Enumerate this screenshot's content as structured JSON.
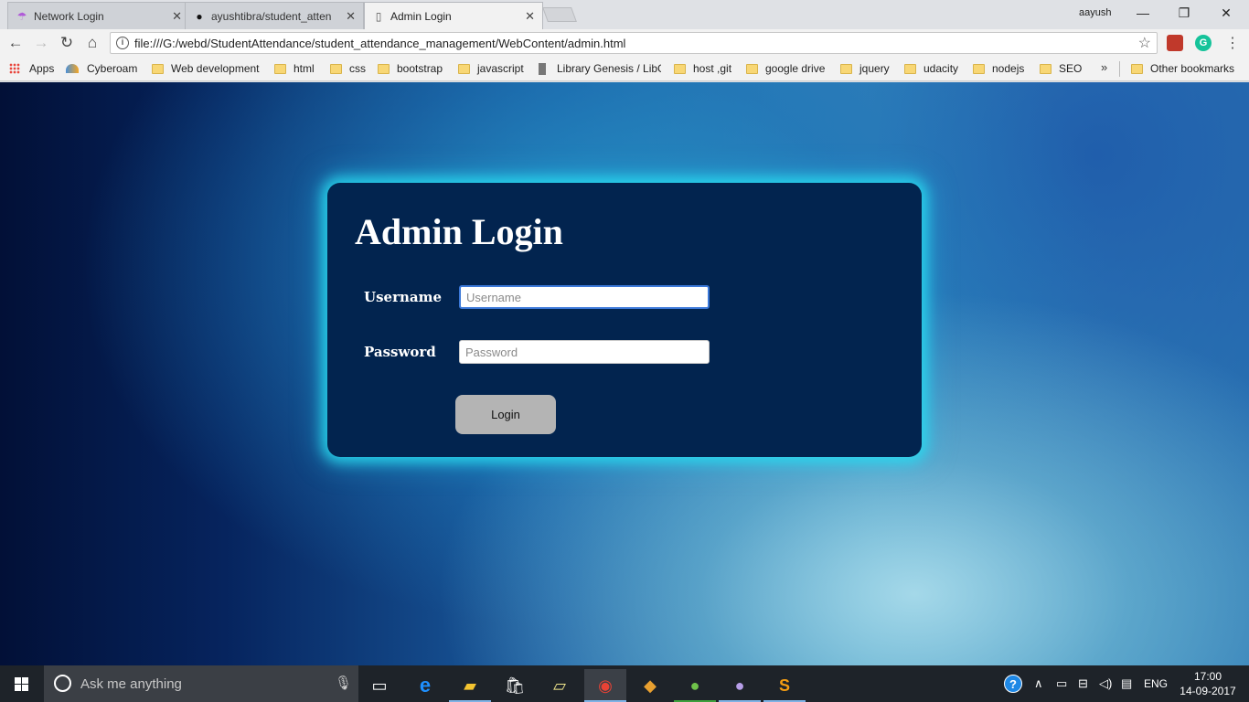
{
  "browser": {
    "tabs": [
      {
        "title": "Network Login",
        "icon": "network-icon",
        "active": false
      },
      {
        "title": "ayushtibra/student_atten",
        "icon": "github-icon",
        "active": false
      },
      {
        "title": "Admin Login",
        "icon": "page-icon",
        "active": true
      }
    ],
    "profile_name": "aayush",
    "url": "file:///G:/webd/StudentAttendance/student_attendance_management/WebContent/admin.html"
  },
  "bookmarks": {
    "items": [
      {
        "label": "Apps",
        "icon": "apps-grid-icon"
      },
      {
        "label": "Cyberoam",
        "icon": "cyberoam-icon"
      },
      {
        "label": "Web development",
        "icon": "folder-icon"
      },
      {
        "label": "html",
        "icon": "folder-icon"
      },
      {
        "label": "css",
        "icon": "folder-icon"
      },
      {
        "label": "bootstrap",
        "icon": "folder-icon"
      },
      {
        "label": "javascript",
        "icon": "folder-icon"
      },
      {
        "label": "Library Genesis / LibG",
        "icon": "book-icon"
      },
      {
        "label": "host ,git",
        "icon": "folder-icon"
      },
      {
        "label": "google drive",
        "icon": "folder-icon"
      },
      {
        "label": "jquery",
        "icon": "folder-icon"
      },
      {
        "label": "udacity",
        "icon": "folder-icon"
      },
      {
        "label": "nodejs",
        "icon": "folder-icon"
      },
      {
        "label": "SEO",
        "icon": "folder-icon"
      }
    ],
    "overflow": "»",
    "other": "Other bookmarks"
  },
  "login": {
    "title": "Admin Login",
    "username_label": "Username",
    "username_placeholder": "Username",
    "username_value": "",
    "password_label": "Password",
    "password_placeholder": "Password",
    "password_value": "",
    "button_label": "Login"
  },
  "taskbar": {
    "search_placeholder": "Ask me anything",
    "language": "ENG",
    "time": "17:00",
    "date": "14-09-2017"
  },
  "colors": {
    "card_background": "#02244f",
    "card_glow": "#28dcf0",
    "button_background": "#b4b4b4"
  }
}
